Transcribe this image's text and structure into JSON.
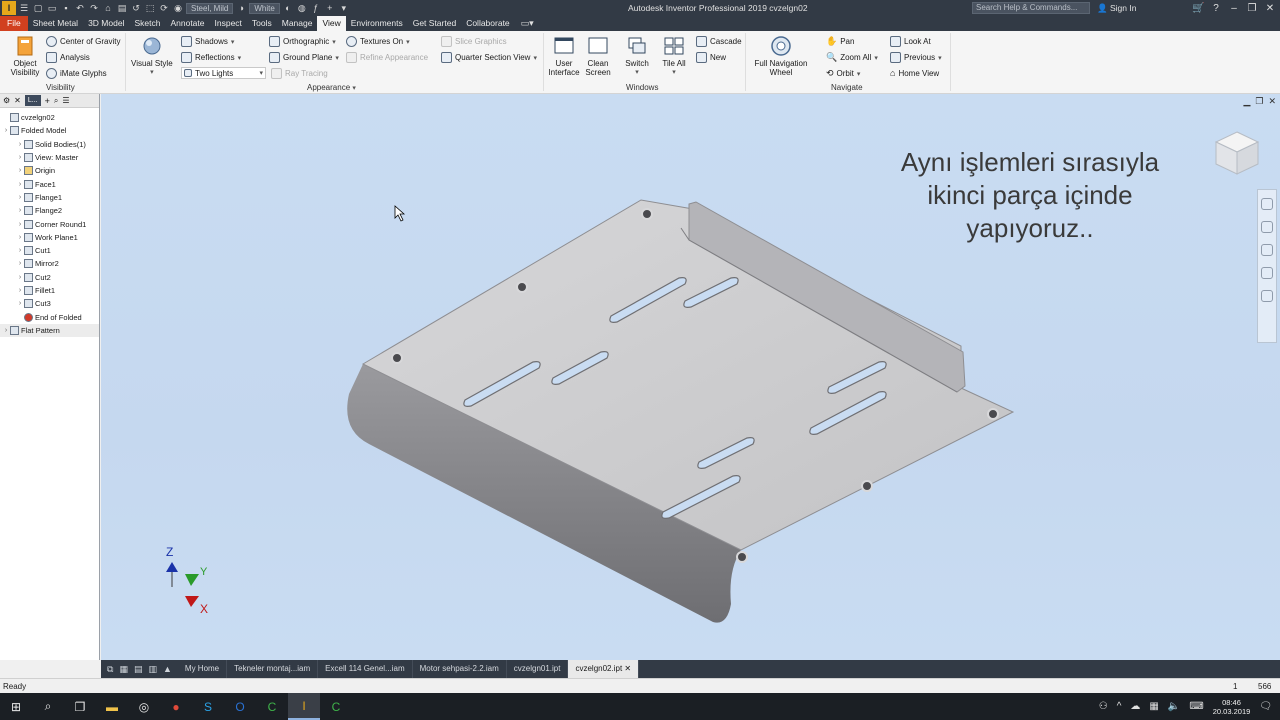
{
  "titlebar": {
    "material": "Steel, Mild",
    "appearance": "White",
    "title": "Autodesk Inventor Professional 2019   cvzelgn02",
    "search_placeholder": "Search Help & Commands...",
    "signin": "Sign In"
  },
  "tabs": [
    "File",
    "Sheet Metal",
    "3D Model",
    "Sketch",
    "Annotate",
    "Inspect",
    "Tools",
    "Manage",
    "View",
    "Environments",
    "Get Started",
    "Collaborate"
  ],
  "active_tab": "View",
  "ribbon": {
    "visibility": {
      "object_visibility": "Object Visibility",
      "center_of_gravity": "Center of Gravity",
      "analysis": "Analysis",
      "imate_glyphs": "iMate Glyphs",
      "label": "Visibility"
    },
    "appearance": {
      "visual_style": "Visual Style",
      "shadows": "Shadows",
      "reflections": "Reflections",
      "two_lights": "Two Lights",
      "orthographic": "Orthographic",
      "ground_plane": "Ground Plane",
      "ray_tracing": "Ray Tracing",
      "textures_on": "Textures On",
      "refine_appearance": "Refine Appearance",
      "slice_graphics": "Slice Graphics",
      "quarter_section_view": "Quarter Section View",
      "label": "Appearance"
    },
    "windows": {
      "user_interface": "User Interface",
      "clean_screen": "Clean Screen",
      "switch": "Switch",
      "tile_all": "Tile All",
      "cascade": "Cascade",
      "new": "New",
      "label": "Windows"
    },
    "navigate": {
      "full_navigation_wheel": "Full Navigation Wheel",
      "pan": "Pan",
      "zoom_all": "Zoom All",
      "orbit": "Orbit",
      "look_at": "Look At",
      "previous": "Previous",
      "home_view": "Home View",
      "label": "Navigate"
    }
  },
  "browser": {
    "tab_label": "L...",
    "tree": [
      {
        "label": "cvzelgn02",
        "level": 0
      },
      {
        "label": "Folded Model",
        "level": 0
      },
      {
        "label": "Solid Bodies(1)",
        "level": 1
      },
      {
        "label": "View: Master",
        "level": 1
      },
      {
        "label": "Origin",
        "level": 1
      },
      {
        "label": "Face1",
        "level": 1
      },
      {
        "label": "Flange1",
        "level": 1
      },
      {
        "label": "Flange2",
        "level": 1
      },
      {
        "label": "Corner Round1",
        "level": 1
      },
      {
        "label": "Work Plane1",
        "level": 1
      },
      {
        "label": "Cut1",
        "level": 1
      },
      {
        "label": "Mirror2",
        "level": 1
      },
      {
        "label": "Cut2",
        "level": 1
      },
      {
        "label": "Fillet1",
        "level": 1
      },
      {
        "label": "Cut3",
        "level": 1
      },
      {
        "label": "End of Folded",
        "level": 1
      },
      {
        "label": "Flat Pattern",
        "level": 0
      }
    ]
  },
  "viewport": {
    "note_lines": [
      "Aynı işlemleri sırasıyla",
      "ikinci parça içinde",
      "yapıyoruz.."
    ],
    "axis": {
      "z": "Z",
      "y": "Y",
      "x": "X"
    },
    "part_color": "#c8c8ca"
  },
  "doctabs": [
    "My Home",
    "Tekneler montaj...iam",
    "Excell 114 Genel...iam",
    "Motor sehpasi-2.2.iam",
    "cvzelgn01.ipt",
    "cvzelgn02.ipt"
  ],
  "active_doctab": "cvzelgn02.ipt",
  "status": {
    "text": "Ready",
    "value1": "1",
    "value2": "566"
  },
  "clock": {
    "time": "08:46",
    "date": "20.03.2019"
  }
}
